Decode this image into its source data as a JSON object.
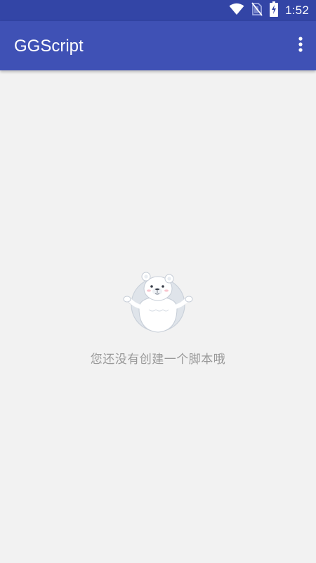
{
  "status_bar": {
    "time": "1:52",
    "icons": [
      "wifi-icon",
      "no-sim-icon",
      "battery-charging-icon"
    ]
  },
  "app_bar": {
    "title": "GGScript",
    "menu_icon": "more-vertical-icon"
  },
  "empty_state": {
    "illustration": "polar-bear-shrug-icon",
    "message": "您还没有创建一个脚本哦"
  },
  "colors": {
    "status_bar": "#3345a6",
    "app_bar": "#3f51b5",
    "background": "#f2f2f2",
    "empty_text": "#999999"
  }
}
